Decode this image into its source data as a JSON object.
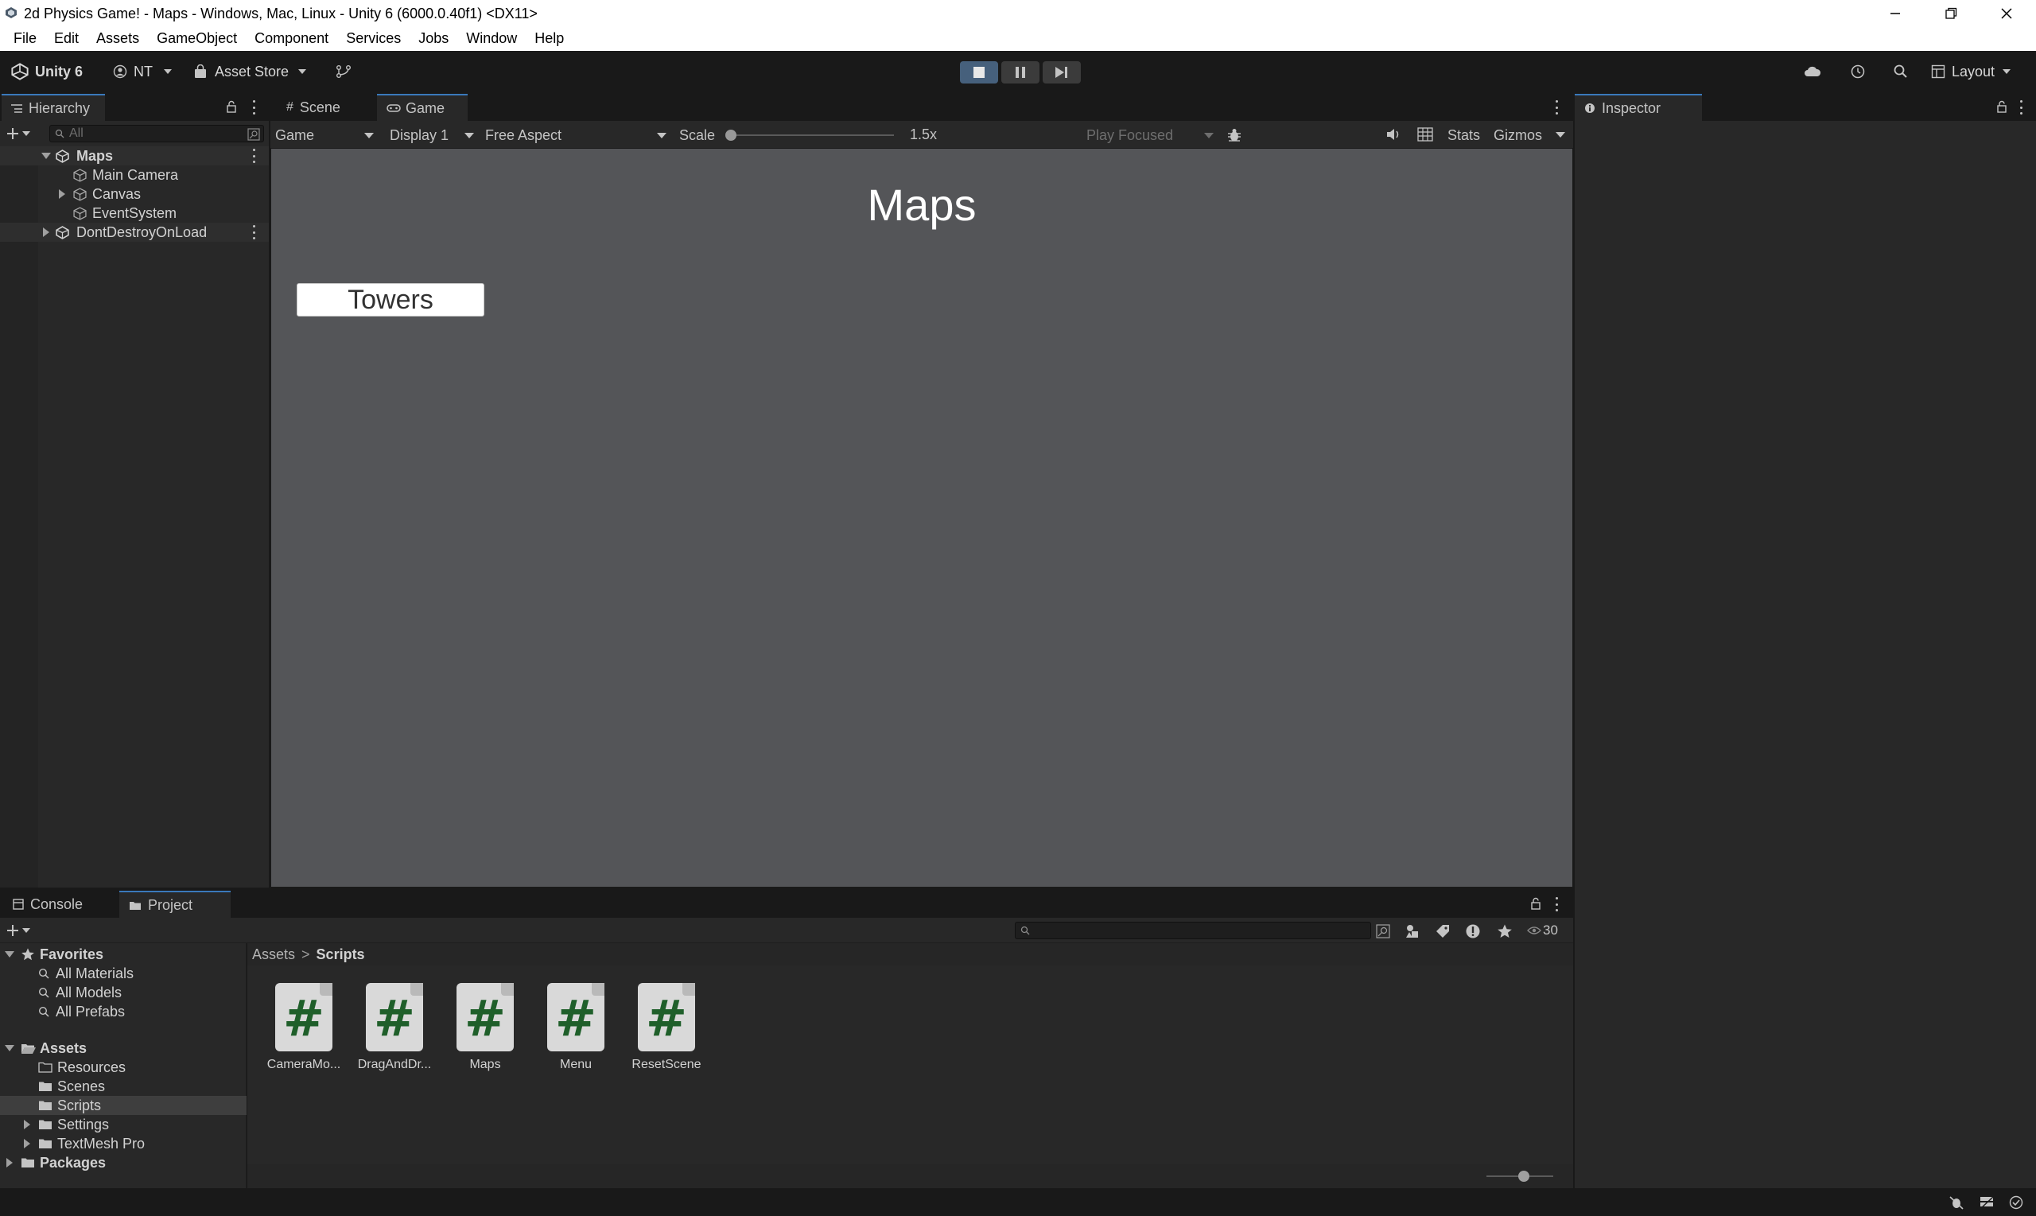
{
  "window": {
    "title": "2d Physics Game! - Maps - Windows, Mac, Linux - Unity 6 (6000.0.40f1) <DX11>"
  },
  "menu": [
    "File",
    "Edit",
    "Assets",
    "GameObject",
    "Component",
    "Services",
    "Jobs",
    "Window",
    "Help"
  ],
  "toolbar": {
    "unity_label": "Unity 6",
    "account_label": "NT",
    "asset_store_label": "Asset Store",
    "layout_label": "Layout"
  },
  "hierarchy": {
    "tab_label": "Hierarchy",
    "search_placeholder": "All",
    "items": [
      {
        "label": "Maps",
        "level": 0,
        "bold": true
      },
      {
        "label": "Main Camera",
        "level": 2
      },
      {
        "label": "Canvas",
        "level": 2
      },
      {
        "label": "EventSystem",
        "level": 2
      },
      {
        "label": "DontDestroyOnLoad",
        "level": 0
      }
    ]
  },
  "center": {
    "tabs": [
      "Scene",
      "Game"
    ],
    "active_tab": "Game",
    "game_toolbar": {
      "mode": "Game",
      "display": "Display 1",
      "aspect": "Free Aspect",
      "scale_label": "Scale",
      "scale_value": "1.5x",
      "play_focused": "Play Focused",
      "stats": "Stats",
      "gizmos": "Gizmos"
    },
    "game_view": {
      "heading": "Maps",
      "button_label": "Towers"
    }
  },
  "inspector": {
    "tab_label": "Inspector"
  },
  "bottom": {
    "tabs": [
      "Console",
      "Project"
    ],
    "active_tab": "Project",
    "visible_count": "30",
    "favorites": {
      "label": "Favorites",
      "items": [
        "All Materials",
        "All Models",
        "All Prefabs"
      ]
    },
    "assets": {
      "label": "Assets",
      "items": [
        "Resources",
        "Scenes",
        "Scripts",
        "Settings",
        "TextMesh Pro"
      ]
    },
    "packages_label": "Packages",
    "breadcrumb": [
      "Assets",
      "Scripts"
    ],
    "files": [
      "CameraMo...",
      "DragAndDr...",
      "Maps",
      "Menu",
      "ResetScene"
    ]
  },
  "colors": {
    "editor_bg": "#191919",
    "panel_bg": "#282828",
    "game_view_bg": "#545558",
    "accent": "#3a79bb",
    "selection": "#2c5d87"
  }
}
